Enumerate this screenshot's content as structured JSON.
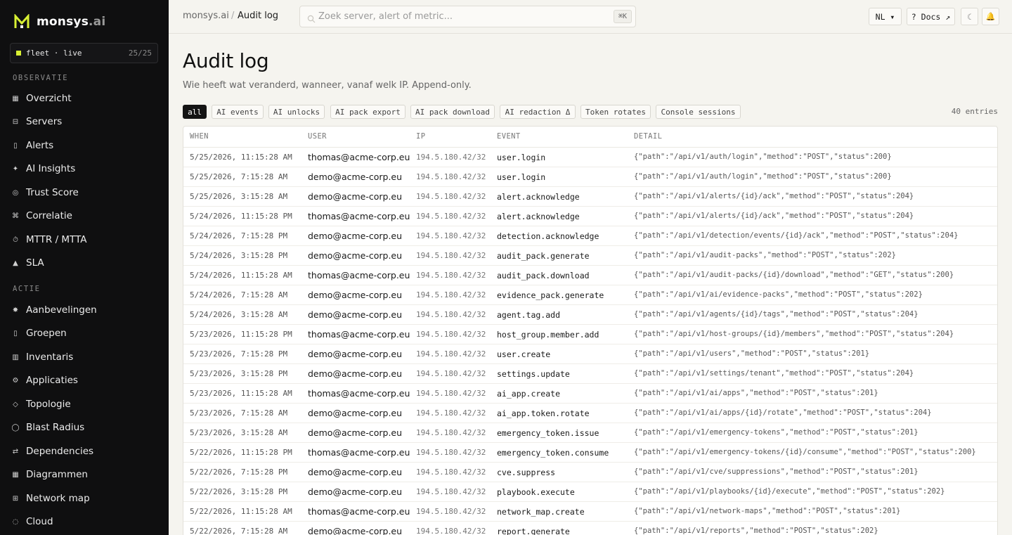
{
  "brand": {
    "name": "monsys",
    "tld": ".ai"
  },
  "fleet": {
    "label": "fleet · live",
    "count": "25/25"
  },
  "sidebar": {
    "section_observe": "OBSERVATIE",
    "section_action": "ACTIE",
    "items": [
      {
        "label": "Overzicht",
        "icon": "grid-icon"
      },
      {
        "label": "Servers",
        "icon": "server-icon"
      },
      {
        "label": "Alerts",
        "icon": "bell-icon"
      },
      {
        "label": "AI Insights",
        "icon": "sparkle-icon"
      },
      {
        "label": "Trust Score",
        "icon": "target-icon"
      },
      {
        "label": "Correlatie",
        "icon": "link-icon"
      },
      {
        "label": "MTTR / MTTA",
        "icon": "timer-icon"
      },
      {
        "label": "SLA",
        "icon": "triangle-icon"
      },
      {
        "label": "Aanbevelingen",
        "icon": "star-icon"
      },
      {
        "label": "Groepen",
        "icon": "folder-icon"
      },
      {
        "label": "Inventaris",
        "icon": "list-icon"
      },
      {
        "label": "Applicaties",
        "icon": "gear-icon"
      },
      {
        "label": "Topologie",
        "icon": "diamond-icon"
      },
      {
        "label": "Blast Radius",
        "icon": "circle-icon"
      },
      {
        "label": "Dependencies",
        "icon": "arrows-icon"
      },
      {
        "label": "Diagrammen",
        "icon": "table-icon"
      },
      {
        "label": "Network map",
        "icon": "network-icon"
      },
      {
        "label": "Cloud",
        "icon": "cloud-icon"
      }
    ]
  },
  "topbar": {
    "crumb_root": "monsys.ai",
    "crumb_sep": "/",
    "crumb_current": "Audit log",
    "search_placeholder": "Zoek server, alert of metric...",
    "search_shortcut": "⌘K",
    "lang": "NL ▾",
    "docs": "? Docs ↗",
    "theme_glyph": "☾",
    "alert_glyph": "🔔"
  },
  "page": {
    "title": "Audit log",
    "subtitle": "Wie heeft wat veranderd, wanneer, vanaf welk IP. Append-only.",
    "filters": [
      "all",
      "AI events",
      "AI unlocks",
      "AI pack export",
      "AI pack download",
      "AI redaction Δ",
      "Token rotates",
      "Console sessions"
    ],
    "active_filter": "all",
    "entries_label": "40 entries"
  },
  "table": {
    "columns": [
      "WHEN",
      "USER",
      "IP",
      "EVENT",
      "DETAIL"
    ],
    "rows": [
      [
        "5/25/2026, 11:15:28 AM",
        "thomas@acme-corp.eu",
        "194.5.180.42/32",
        "user.login",
        "{\"path\":\"/api/v1/auth/login\",\"method\":\"POST\",\"status\":200}"
      ],
      [
        "5/25/2026, 7:15:28 AM",
        "demo@acme-corp.eu",
        "194.5.180.42/32",
        "user.login",
        "{\"path\":\"/api/v1/auth/login\",\"method\":\"POST\",\"status\":200}"
      ],
      [
        "5/25/2026, 3:15:28 AM",
        "demo@acme-corp.eu",
        "194.5.180.42/32",
        "alert.acknowledge",
        "{\"path\":\"/api/v1/alerts/{id}/ack\",\"method\":\"POST\",\"status\":204}"
      ],
      [
        "5/24/2026, 11:15:28 PM",
        "thomas@acme-corp.eu",
        "194.5.180.42/32",
        "alert.acknowledge",
        "{\"path\":\"/api/v1/alerts/{id}/ack\",\"method\":\"POST\",\"status\":204}"
      ],
      [
        "5/24/2026, 7:15:28 PM",
        "demo@acme-corp.eu",
        "194.5.180.42/32",
        "detection.acknowledge",
        "{\"path\":\"/api/v1/detection/events/{id}/ack\",\"method\":\"POST\",\"status\":204}"
      ],
      [
        "5/24/2026, 3:15:28 PM",
        "demo@acme-corp.eu",
        "194.5.180.42/32",
        "audit_pack.generate",
        "{\"path\":\"/api/v1/audit-packs\",\"method\":\"POST\",\"status\":202}"
      ],
      [
        "5/24/2026, 11:15:28 AM",
        "thomas@acme-corp.eu",
        "194.5.180.42/32",
        "audit_pack.download",
        "{\"path\":\"/api/v1/audit-packs/{id}/download\",\"method\":\"GET\",\"status\":200}"
      ],
      [
        "5/24/2026, 7:15:28 AM",
        "demo@acme-corp.eu",
        "194.5.180.42/32",
        "evidence_pack.generate",
        "{\"path\":\"/api/v1/ai/evidence-packs\",\"method\":\"POST\",\"status\":202}"
      ],
      [
        "5/24/2026, 3:15:28 AM",
        "demo@acme-corp.eu",
        "194.5.180.42/32",
        "agent.tag.add",
        "{\"path\":\"/api/v1/agents/{id}/tags\",\"method\":\"POST\",\"status\":204}"
      ],
      [
        "5/23/2026, 11:15:28 PM",
        "thomas@acme-corp.eu",
        "194.5.180.42/32",
        "host_group.member.add",
        "{\"path\":\"/api/v1/host-groups/{id}/members\",\"method\":\"POST\",\"status\":204}"
      ],
      [
        "5/23/2026, 7:15:28 PM",
        "demo@acme-corp.eu",
        "194.5.180.42/32",
        "user.create",
        "{\"path\":\"/api/v1/users\",\"method\":\"POST\",\"status\":201}"
      ],
      [
        "5/23/2026, 3:15:28 PM",
        "demo@acme-corp.eu",
        "194.5.180.42/32",
        "settings.update",
        "{\"path\":\"/api/v1/settings/tenant\",\"method\":\"POST\",\"status\":204}"
      ],
      [
        "5/23/2026, 11:15:28 AM",
        "thomas@acme-corp.eu",
        "194.5.180.42/32",
        "ai_app.create",
        "{\"path\":\"/api/v1/ai/apps\",\"method\":\"POST\",\"status\":201}"
      ],
      [
        "5/23/2026, 7:15:28 AM",
        "demo@acme-corp.eu",
        "194.5.180.42/32",
        "ai_app.token.rotate",
        "{\"path\":\"/api/v1/ai/apps/{id}/rotate\",\"method\":\"POST\",\"status\":204}"
      ],
      [
        "5/23/2026, 3:15:28 AM",
        "demo@acme-corp.eu",
        "194.5.180.42/32",
        "emergency_token.issue",
        "{\"path\":\"/api/v1/emergency-tokens\",\"method\":\"POST\",\"status\":201}"
      ],
      [
        "5/22/2026, 11:15:28 PM",
        "thomas@acme-corp.eu",
        "194.5.180.42/32",
        "emergency_token.consume",
        "{\"path\":\"/api/v1/emergency-tokens/{id}/consume\",\"method\":\"POST\",\"status\":200}"
      ],
      [
        "5/22/2026, 7:15:28 PM",
        "demo@acme-corp.eu",
        "194.5.180.42/32",
        "cve.suppress",
        "{\"path\":\"/api/v1/cve/suppressions\",\"method\":\"POST\",\"status\":201}"
      ],
      [
        "5/22/2026, 3:15:28 PM",
        "demo@acme-corp.eu",
        "194.5.180.42/32",
        "playbook.execute",
        "{\"path\":\"/api/v1/playbooks/{id}/execute\",\"method\":\"POST\",\"status\":202}"
      ],
      [
        "5/22/2026, 11:15:28 AM",
        "thomas@acme-corp.eu",
        "194.5.180.42/32",
        "network_map.create",
        "{\"path\":\"/api/v1/network-maps\",\"method\":\"POST\",\"status\":201}"
      ],
      [
        "5/22/2026, 7:15:28 AM",
        "demo@acme-corp.eu",
        "194.5.180.42/32",
        "report.generate",
        "{\"path\":\"/api/v1/reports\",\"method\":\"POST\",\"status\":202}"
      ]
    ]
  },
  "colors": {
    "sidebar_bg": "#0f0f10",
    "accent": "#d8f033",
    "page_bg": "#f5f4ef"
  }
}
